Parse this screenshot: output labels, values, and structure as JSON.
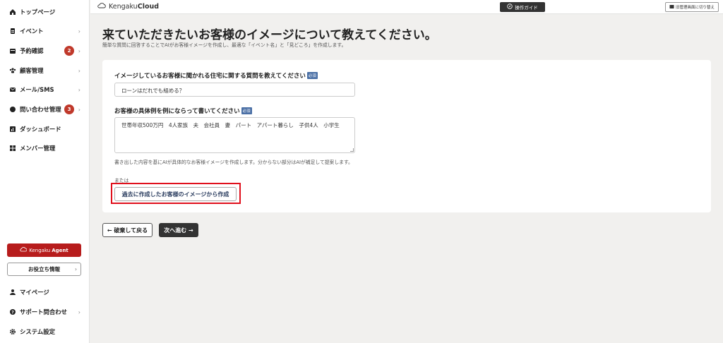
{
  "sidebar": {
    "items": [
      {
        "label": "トップページ",
        "icon": "home-icon"
      },
      {
        "label": "イベント",
        "icon": "document-icon",
        "chevron": "›"
      },
      {
        "label": "予約確認",
        "icon": "calendar-icon",
        "badge": "2",
        "chevron": "›"
      },
      {
        "label": "顧客管理",
        "icon": "users-icon",
        "chevron": "›"
      },
      {
        "label": "メール/SMS",
        "icon": "mail-icon",
        "chevron": "›"
      },
      {
        "label": "問い合わせ管理",
        "icon": "chat-icon",
        "badge": "3",
        "chevron": "›"
      },
      {
        "label": "ダッシュボード",
        "icon": "chart-icon"
      },
      {
        "label": "メンバー管理",
        "icon": "grid-icon"
      }
    ],
    "agent_label_pre": "Kengaku",
    "agent_label_bold": "Agent",
    "useful_label": "お役立ち情報",
    "bottom_items": [
      {
        "label": "マイページ",
        "icon": "user-icon"
      },
      {
        "label": "サポート問合わせ",
        "icon": "help-icon",
        "chevron": "›"
      },
      {
        "label": "システム設定",
        "icon": "gear-icon"
      }
    ]
  },
  "topbar": {
    "logo_pre": "Kengaku",
    "logo_bold": "Cloud",
    "guide_label": "操作ガイド",
    "switch_label": "旧管理画面に切り替え"
  },
  "main": {
    "title": "来ていただきたいお客様のイメージについて教えてください。",
    "subtitle": "簡単な質問に回答することでAIがお客様イメージを作成し、最適な「イベント名」と「見どころ」を作成します。",
    "q1_label": "イメージしているお客様に聞かれる住宅に関する質問を教えてください",
    "q1_value": "ローンはだれでも組める？",
    "q2_label": "お客様の具体例を例にならって書いてください",
    "q2_value": "世帯年収500万円　4人家族　夫　会社員　妻　パート　アパート暮らし　子供4人　小学生",
    "required_tag": "必須",
    "hint": "書き出した内容を基にAIが具体的なお客様イメージを作成します。分からない部分はAIが補足して提案します。",
    "or_label": "または",
    "past_button": "過去に作成したお客様のイメージから作成",
    "back_button": "← 破棄して戻る",
    "next_button": "次へ進む →"
  },
  "colors": {
    "accent_red": "#b71c1c",
    "badge_red": "#c0392b",
    "highlight_red": "#e0101c",
    "dark_button": "#333333"
  }
}
